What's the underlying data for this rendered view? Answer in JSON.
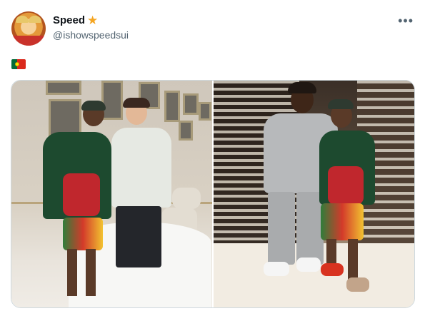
{
  "post": {
    "author": {
      "display_name": "Speed",
      "handle": "@ishowspeedsui",
      "verified_icon": "star-icon"
    },
    "text_icon": "portugal-flag-icon",
    "more_icon": "more-options-icon",
    "media": [
      {
        "icon": "photo",
        "description": ""
      },
      {
        "icon": "photo",
        "description": ""
      }
    ]
  },
  "colors": {
    "name": "#0f1419",
    "handle": "#536471",
    "star": "#f5a623",
    "border": "#cfd9de"
  }
}
